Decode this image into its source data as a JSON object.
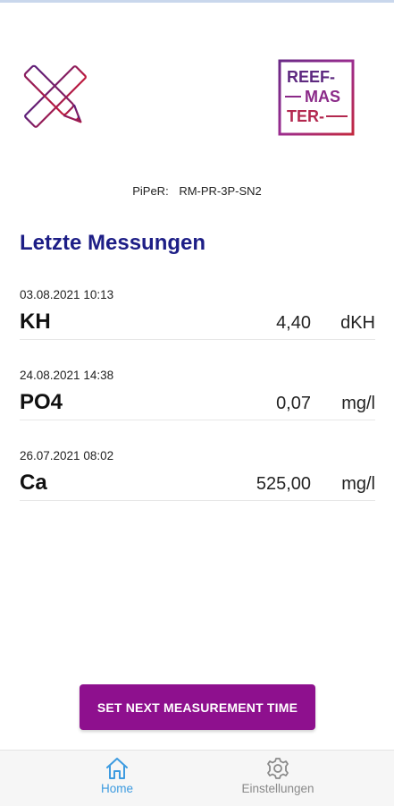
{
  "brand": {
    "logo_text_lines": [
      "REEF-",
      "MAS",
      "TER-"
    ]
  },
  "device": {
    "label": "PiPeR:",
    "id": "RM-PR-3P-SN2"
  },
  "section_title": "Letzte Messungen",
  "measurements": [
    {
      "date": "03.08.2021 10:13",
      "param": "KH",
      "value": "4,40",
      "unit": "dKH"
    },
    {
      "date": "24.08.2021 14:38",
      "param": "PO4",
      "value": "0,07",
      "unit": "mg/l"
    },
    {
      "date": "26.07.2021 08:02",
      "param": "Ca",
      "value": "525,00",
      "unit": "mg/l"
    }
  ],
  "cta": {
    "label": "SET NEXT MEASUREMENT TIME"
  },
  "tabs": [
    {
      "label": "Home",
      "icon": "home-icon",
      "active": true
    },
    {
      "label": "Einstellungen",
      "icon": "gear-icon",
      "active": false
    }
  ],
  "colors": {
    "title": "#1d1e86",
    "cta_bg": "#8e108e",
    "tab_active": "#3d9be0",
    "tab_inactive": "#8a8a8a"
  }
}
